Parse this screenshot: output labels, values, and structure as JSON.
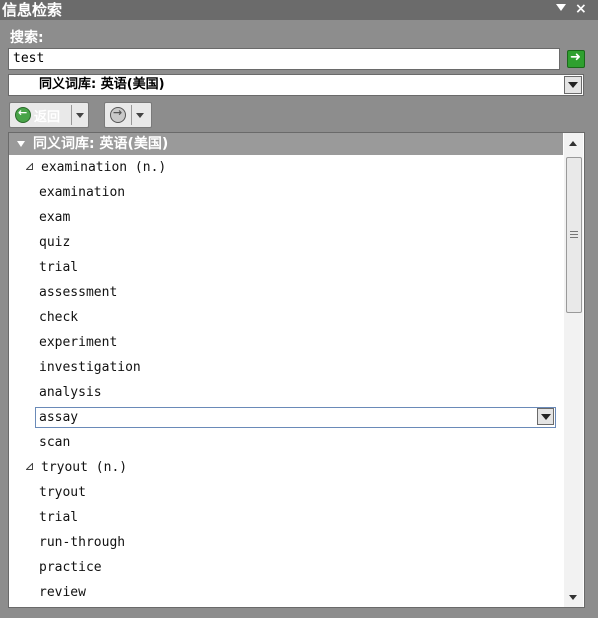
{
  "titlebar": {
    "title": "信息检索",
    "close_glyph": "×"
  },
  "search": {
    "label": "搜索:",
    "value": "test",
    "go_icon": "go-arrow-icon"
  },
  "source": {
    "selected": "同义词库: 英语(美国)"
  },
  "nav": {
    "back_label": "返回",
    "back_icon": "back-arrow-icon",
    "forward_icon": "forward-arrow-icon"
  },
  "results": {
    "header": "同义词库: 英语(美国)",
    "rows": [
      {
        "kind": "group",
        "text": "examination (n.)"
      },
      {
        "kind": "item",
        "text": "examination"
      },
      {
        "kind": "item",
        "text": "exam"
      },
      {
        "kind": "item",
        "text": "quiz"
      },
      {
        "kind": "item",
        "text": "trial"
      },
      {
        "kind": "item",
        "text": "assessment"
      },
      {
        "kind": "item",
        "text": "check"
      },
      {
        "kind": "item",
        "text": "experiment"
      },
      {
        "kind": "item",
        "text": "investigation"
      },
      {
        "kind": "item",
        "text": "analysis"
      },
      {
        "kind": "item",
        "text": "assay",
        "selected": true
      },
      {
        "kind": "item",
        "text": "scan"
      },
      {
        "kind": "group",
        "text": "tryout (n.)"
      },
      {
        "kind": "item",
        "text": "tryout"
      },
      {
        "kind": "item",
        "text": "trial"
      },
      {
        "kind": "item",
        "text": "run-through"
      },
      {
        "kind": "item",
        "text": "practice"
      },
      {
        "kind": "item",
        "text": "review"
      }
    ]
  },
  "colors": {
    "pane_bg": "#8d8d8d",
    "titlebar_bg": "#6b6b6b",
    "header_bg": "#9a9a9a",
    "go_green": "#2fa02f"
  }
}
